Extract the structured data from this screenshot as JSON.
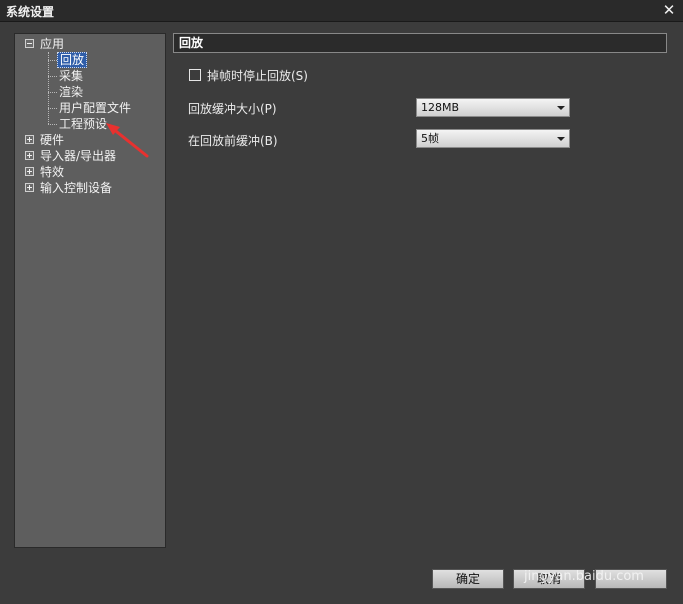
{
  "window": {
    "title": "系统设置",
    "close_glyph": "✕"
  },
  "tree": {
    "items": [
      {
        "label": "应用",
        "expanded": true
      },
      {
        "label": "回放"
      },
      {
        "label": "采集"
      },
      {
        "label": "渲染"
      },
      {
        "label": "用户配置文件"
      },
      {
        "label": "工程预设"
      },
      {
        "label": "硬件",
        "expanded": false
      },
      {
        "label": "导入器/导出器",
        "expanded": false
      },
      {
        "label": "特效",
        "expanded": false
      },
      {
        "label": "输入控制设备",
        "expanded": false
      }
    ],
    "selected": "回放"
  },
  "main": {
    "header": "回放",
    "checkbox_label": "掉帧时停止回放(S)",
    "checkbox_checked": false,
    "buffer_size_label": "回放缓冲大小(P)",
    "buffer_size_value": "128MB",
    "pre_buffer_label": "在回放前缓冲(B)",
    "pre_buffer_value": "5帧"
  },
  "footer": {
    "ok_label": "确定",
    "cancel_label": "取消",
    "help_label": ""
  },
  "watermark": "jingyan.baidu.com",
  "colors": {
    "selected": "#2f5da8",
    "annotation_arrow": "#e8312f"
  }
}
